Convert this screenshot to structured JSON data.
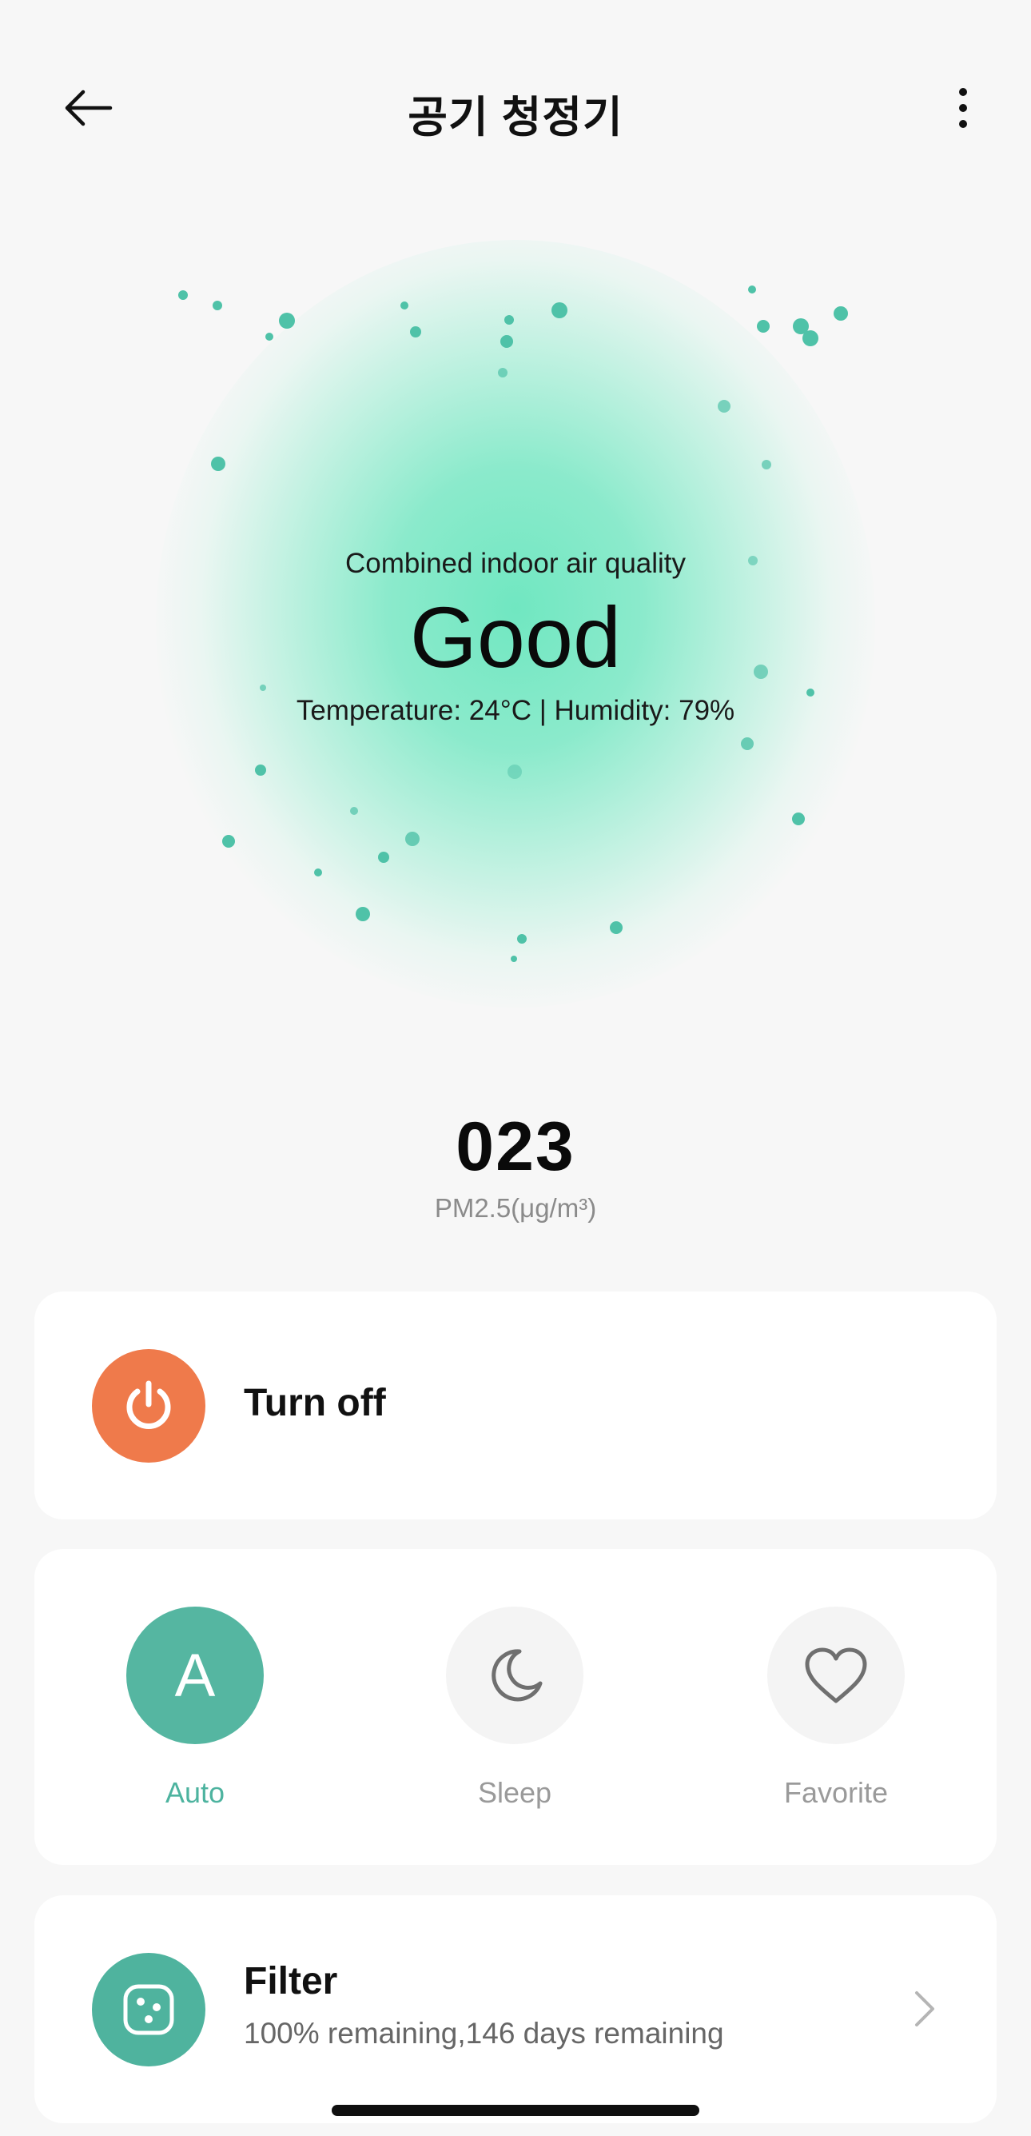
{
  "header": {
    "title": "공기 청정기",
    "back_icon": "arrow-left-icon",
    "more_icon": "more-vertical-icon"
  },
  "hero": {
    "caption": "Combined indoor air quality",
    "status": "Good",
    "details": "Temperature: 24°C | Humidity: 79%",
    "glow_color": "#6fe6bd",
    "particle_color": "#4fc2a8"
  },
  "pm": {
    "value": "023",
    "unit": "PM2.5(μg/m³)"
  },
  "power": {
    "label": "Turn off",
    "icon": "power-icon",
    "color": "#ef7a4b"
  },
  "modes": [
    {
      "label": "Auto",
      "icon": "letter-a-icon",
      "glyph": "A",
      "active": true
    },
    {
      "label": "Sleep",
      "icon": "moon-icon",
      "active": false
    },
    {
      "label": "Favorite",
      "icon": "heart-icon",
      "active": false
    }
  ],
  "filter": {
    "title": "Filter",
    "subtitle": "100% remaining,146 days remaining",
    "icon": "filter-icon",
    "color": "#4fb39e"
  }
}
